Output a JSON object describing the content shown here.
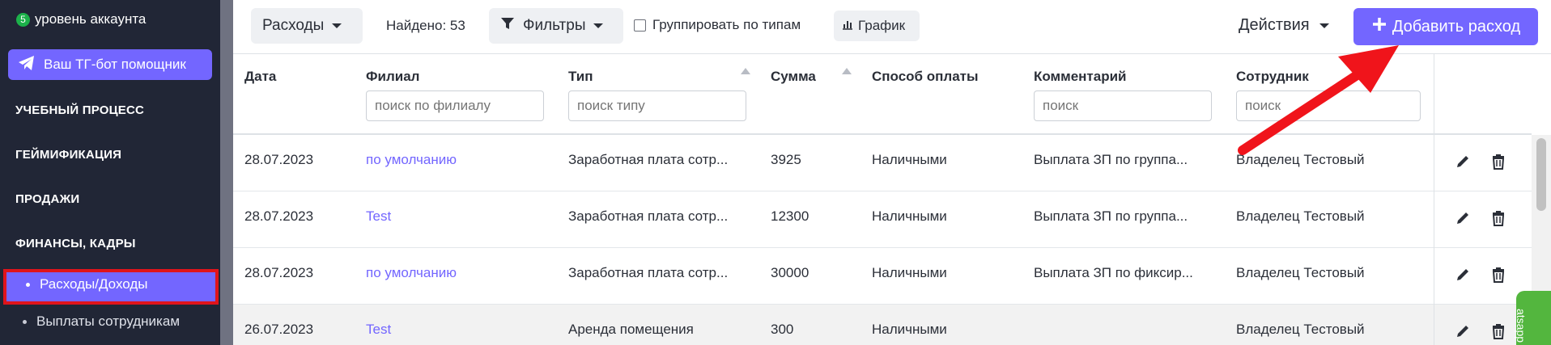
{
  "sidebar": {
    "level_number": "5",
    "account_level": "уровень аккаунта",
    "tg_button": "Ваш ТГ-бот помощник",
    "sections": [
      "УЧЕБНЫЙ ПРОЦЕСС",
      "ГЕЙМИФИКАЦИЯ",
      "ПРОДАЖИ",
      "ФИНАНСЫ, КАДРЫ"
    ],
    "sub_items": [
      "Расходы/Доходы",
      "Выплаты сотрудникам"
    ]
  },
  "toolbar": {
    "type_dropdown": "Расходы",
    "found": "Найдено: 53",
    "filters": "Фильтры",
    "group_by_types": "Группировать по типам",
    "chart": "График",
    "actions": "Действия",
    "add_expense": "Добавить расход"
  },
  "table": {
    "columns": [
      "Дата",
      "Филиал",
      "Тип",
      "Сумма",
      "Способ оплаты",
      "Комментарий",
      "Сотрудник"
    ],
    "filter_placeholders": {
      "branch": "поиск по филиалу",
      "type": "поиск типу",
      "comment": "поиск",
      "employee": "поиск"
    },
    "rows": [
      {
        "date": "28.07.2023",
        "branch": "по умолчанию",
        "type": "Заработная плата сотр...",
        "amount": "3925",
        "payment": "Наличными",
        "comment": "Выплата ЗП по группа...",
        "employee": "Владелец Тестовый"
      },
      {
        "date": "28.07.2023",
        "branch": "Test",
        "type": "Заработная плата сотр...",
        "amount": "12300",
        "payment": "Наличными",
        "comment": "Выплата ЗП по группа...",
        "employee": "Владелец Тестовый"
      },
      {
        "date": "28.07.2023",
        "branch": "по умолчанию",
        "type": "Заработная плата сотр...",
        "amount": "30000",
        "payment": "Наличными",
        "comment": "Выплата ЗП по фиксир...",
        "employee": "Владелец Тестовый"
      },
      {
        "date": "26.07.2023",
        "branch": "Test",
        "type": "Аренда помещения",
        "amount": "300",
        "payment": "Наличными",
        "comment": "",
        "employee": "Владелец Тестовый"
      }
    ]
  },
  "widget": {
    "label": "atsapp"
  },
  "colors": {
    "accent": "#7366ff",
    "sidebar_bg": "#212636",
    "highlight": "#e0141b",
    "arrow": "#f0141b",
    "link": "#7366ff"
  }
}
